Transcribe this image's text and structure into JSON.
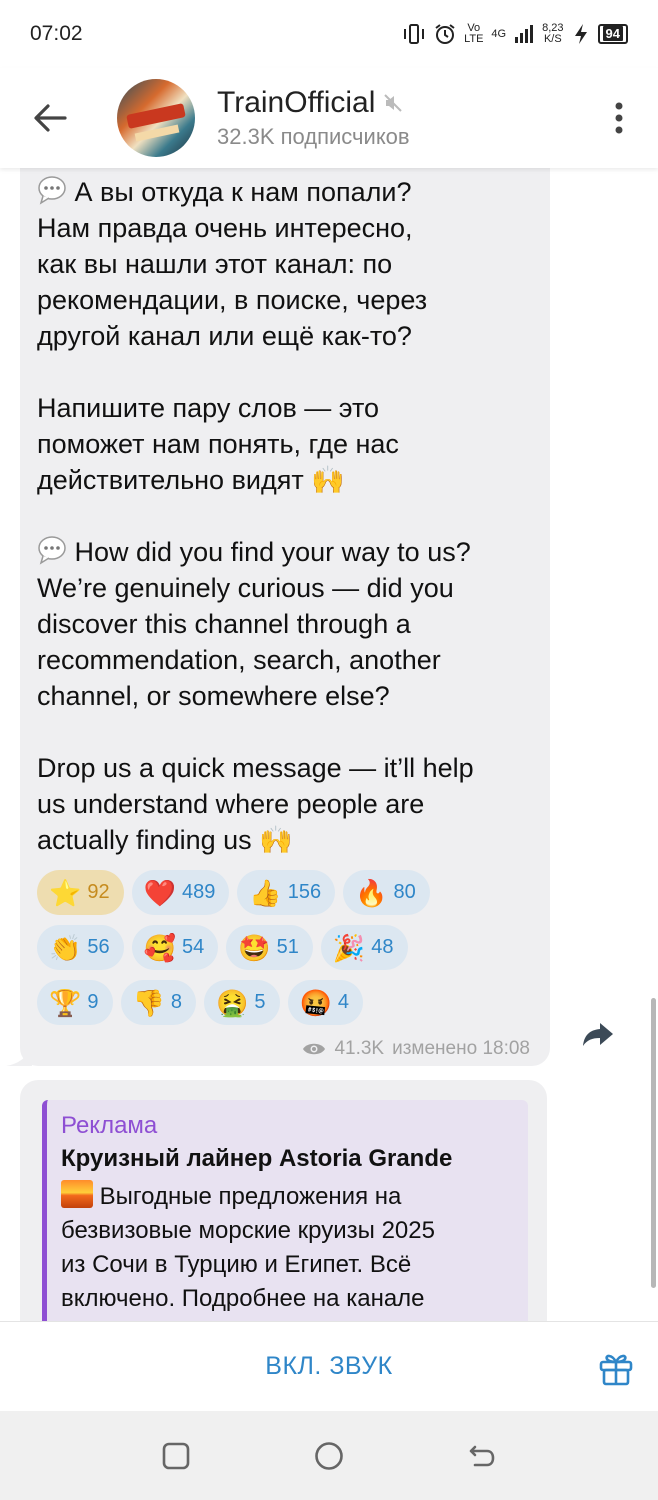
{
  "status_bar": {
    "time": "07:02",
    "net_label_top": "Vo",
    "net_label_bottom": "LTE",
    "gen_label": "4G",
    "speed_top": "8,23",
    "speed_bottom": "K/S",
    "battery": "94"
  },
  "header": {
    "channel_name": "TrainOfficial",
    "subscribers": "32.3K подписчиков"
  },
  "message": {
    "ru_p1": "А вы откуда к нам попали?\nНам правда очень интересно,\nкак вы нашли этот канал: по\nрекомендации, в поиске, через\nдругой канал или ещё как-то?",
    "ru_p2": "Напишите пару слов — это\nпоможет нам понять, где нас\nдействительно видят",
    "en_p1": "How did you find your way to us?\nWe’re genuinely curious — did you\ndiscover this channel through a\nrecommendation, search, another\nchannel, or somewhere else?",
    "en_p2": "Drop us a quick message — it’ll help\nus understand where people are\nactually finding us",
    "emoji_hands": "🙌",
    "views": "41.3K",
    "edited": "изменено 18:08"
  },
  "reactions": [
    {
      "emoji": "⭐",
      "count": "92"
    },
    {
      "emoji": "❤️",
      "count": "489"
    },
    {
      "emoji": "👍",
      "count": "156"
    },
    {
      "emoji": "🔥",
      "count": "80"
    },
    {
      "emoji": "👏",
      "count": "56"
    },
    {
      "emoji": "🥰",
      "count": "54"
    },
    {
      "emoji": "🤩",
      "count": "51"
    },
    {
      "emoji": "🎉",
      "count": "48"
    },
    {
      "emoji": "🏆",
      "count": "9"
    },
    {
      "emoji": "👎",
      "count": "8"
    },
    {
      "emoji": "🤮",
      "count": "5"
    },
    {
      "emoji": "🤬",
      "count": "4"
    }
  ],
  "ad": {
    "label": "Реклама",
    "title": "Круизный лайнер Astoria Grande",
    "text": "Выгодные предложения на\nбезвизовые морские круизы 2025\nиз Сочи в Турцию и Египет. Всё\nвключено. Подробнее на канале"
  },
  "bottom_bar": {
    "unmute_label": "ВКЛ. ЗВУК"
  },
  "colors": {
    "accent": "#2f86c8",
    "ad_accent": "#8e4fd3",
    "bubble": "#efeff1",
    "reaction_bg": "#dce7f1",
    "reaction_active_bg": "#eeddb0"
  },
  "icons": [
    "back-arrow-icon",
    "mute-icon",
    "more-vertical-icon",
    "speech-bubble-icon",
    "eye-icon",
    "share-icon",
    "gift-icon",
    "nav-recents-icon",
    "nav-home-icon",
    "nav-back-icon"
  ]
}
